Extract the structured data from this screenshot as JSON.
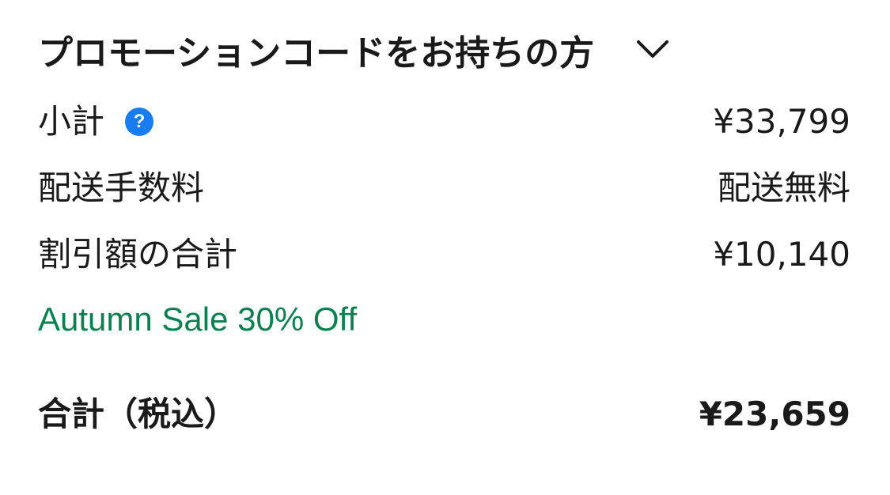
{
  "promo": {
    "label": "プロモーションコードをお持ちの方",
    "toggle_icon": "chevron-down-icon"
  },
  "subtotal": {
    "label": "小計",
    "help_icon": "question-circle-icon",
    "help_glyph": "?",
    "value": "¥33,799"
  },
  "shipping": {
    "label": "配送手数料",
    "value": "配送無料"
  },
  "discount": {
    "label": "割引額の合計",
    "value": "¥10,140",
    "applied_promo": "Autumn Sale 30% Off"
  },
  "total": {
    "label": "合計（税込）",
    "value": "¥23,659"
  },
  "colors": {
    "text": "#1a1a1a",
    "help_icon": "#1a7cf5",
    "promo_applied": "#0a7f4f"
  }
}
